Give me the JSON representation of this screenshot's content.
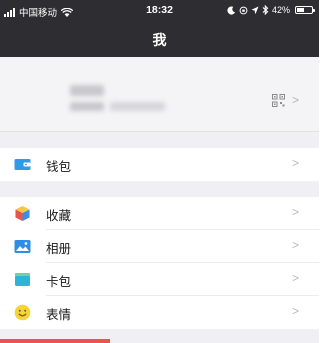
{
  "status_bar": {
    "carrier": "中国移动",
    "time": "18:32",
    "battery_percent": "42%",
    "battery_level": 0.42
  },
  "nav": {
    "title": "我"
  },
  "profile": {
    "qr_icon": "qr-code-icon"
  },
  "menu": {
    "wallet": {
      "label": "钱包",
      "icon": "wallet-icon",
      "color": "#2d9be8"
    },
    "favorites": {
      "label": "收藏",
      "icon": "favorites-cube-icon"
    },
    "album": {
      "label": "相册",
      "icon": "album-icon",
      "color": "#2c8ee6"
    },
    "cards": {
      "label": "卡包",
      "icon": "card-wallet-icon",
      "color": "#2bb5d8"
    },
    "stickers": {
      "label": "表情",
      "icon": "smiley-icon",
      "color": "#f6d338"
    }
  },
  "colors": {
    "header_bg": "#2e2e32",
    "page_bg": "#efeff4",
    "accent_red": "#e8554e"
  }
}
